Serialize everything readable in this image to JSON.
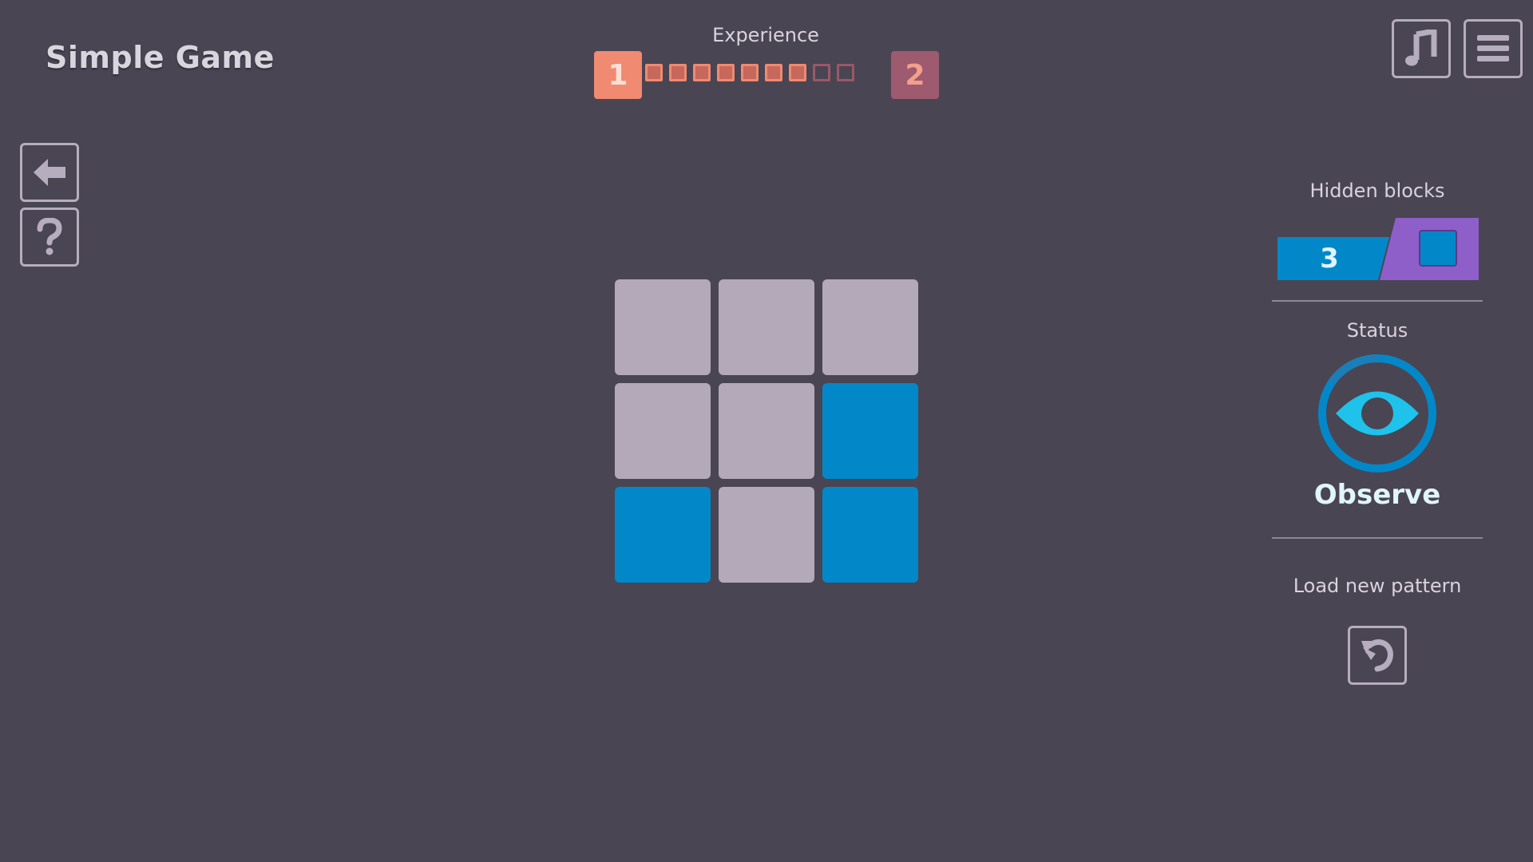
{
  "app": {
    "title": "Simple Game"
  },
  "experience": {
    "label": "Experience",
    "current_level": "1",
    "next_level": "2",
    "filled_pips": 7,
    "total_pips": 9
  },
  "toolbar": {
    "music_icon": "music-note-icon",
    "menu_icon": "hamburger-menu-icon",
    "back_icon": "arrow-left-icon",
    "help_icon": "question-mark-icon"
  },
  "board": {
    "rows": 3,
    "cols": 3,
    "cells": [
      "gray",
      "gray",
      "gray",
      "gray",
      "gray",
      "blue",
      "blue",
      "gray",
      "blue"
    ]
  },
  "side_panel": {
    "hidden_blocks_label": "Hidden blocks",
    "hidden_blocks_count": "3",
    "status_label": "Status",
    "status_value": "Observe",
    "status_icon": "eye-icon",
    "load_label": "Load new pattern",
    "load_icon": "reload-icon"
  },
  "colors": {
    "background": "#4a4552",
    "tile_gray": "#b3a9b9",
    "tile_blue": "#0288c9",
    "xp_current": "#f08a70",
    "xp_next": "#9e5a6e",
    "accent_purple": "#8e5ec9"
  }
}
